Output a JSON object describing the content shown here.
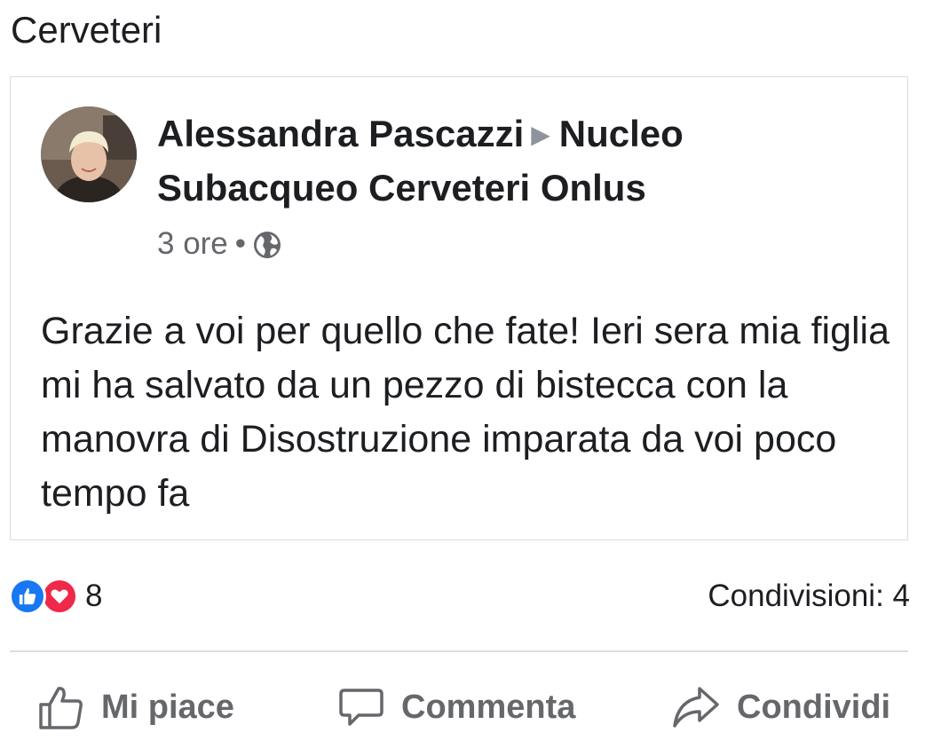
{
  "header": {
    "title": "Cerveteri"
  },
  "post": {
    "author": "Alessandra Pascazzi",
    "separator_icon": "triangle-right-icon",
    "target_group": "Nucleo Subacqueo Cerveteri Onlus",
    "time": "3 ore",
    "dot": "•",
    "privacy_icon": "globe-icon",
    "text": "Grazie a voi per quello che fate! Ieri sera mia figlia mi ha salvato da un pezzo di bistecca con la manovra di Disostruzione imparata da voi poco tempo fa"
  },
  "stats": {
    "reaction_icons": [
      "like-icon",
      "love-icon"
    ],
    "reaction_count": "8",
    "shares": "Condivisioni: 4"
  },
  "actions": {
    "like_label": "Mi piace",
    "comment_label": "Commenta",
    "share_label": "Condividi"
  },
  "colors": {
    "like_blue": "#1877f2",
    "love_red": "#f02849",
    "secondary_text": "#65676b",
    "divider": "#dadde1"
  }
}
